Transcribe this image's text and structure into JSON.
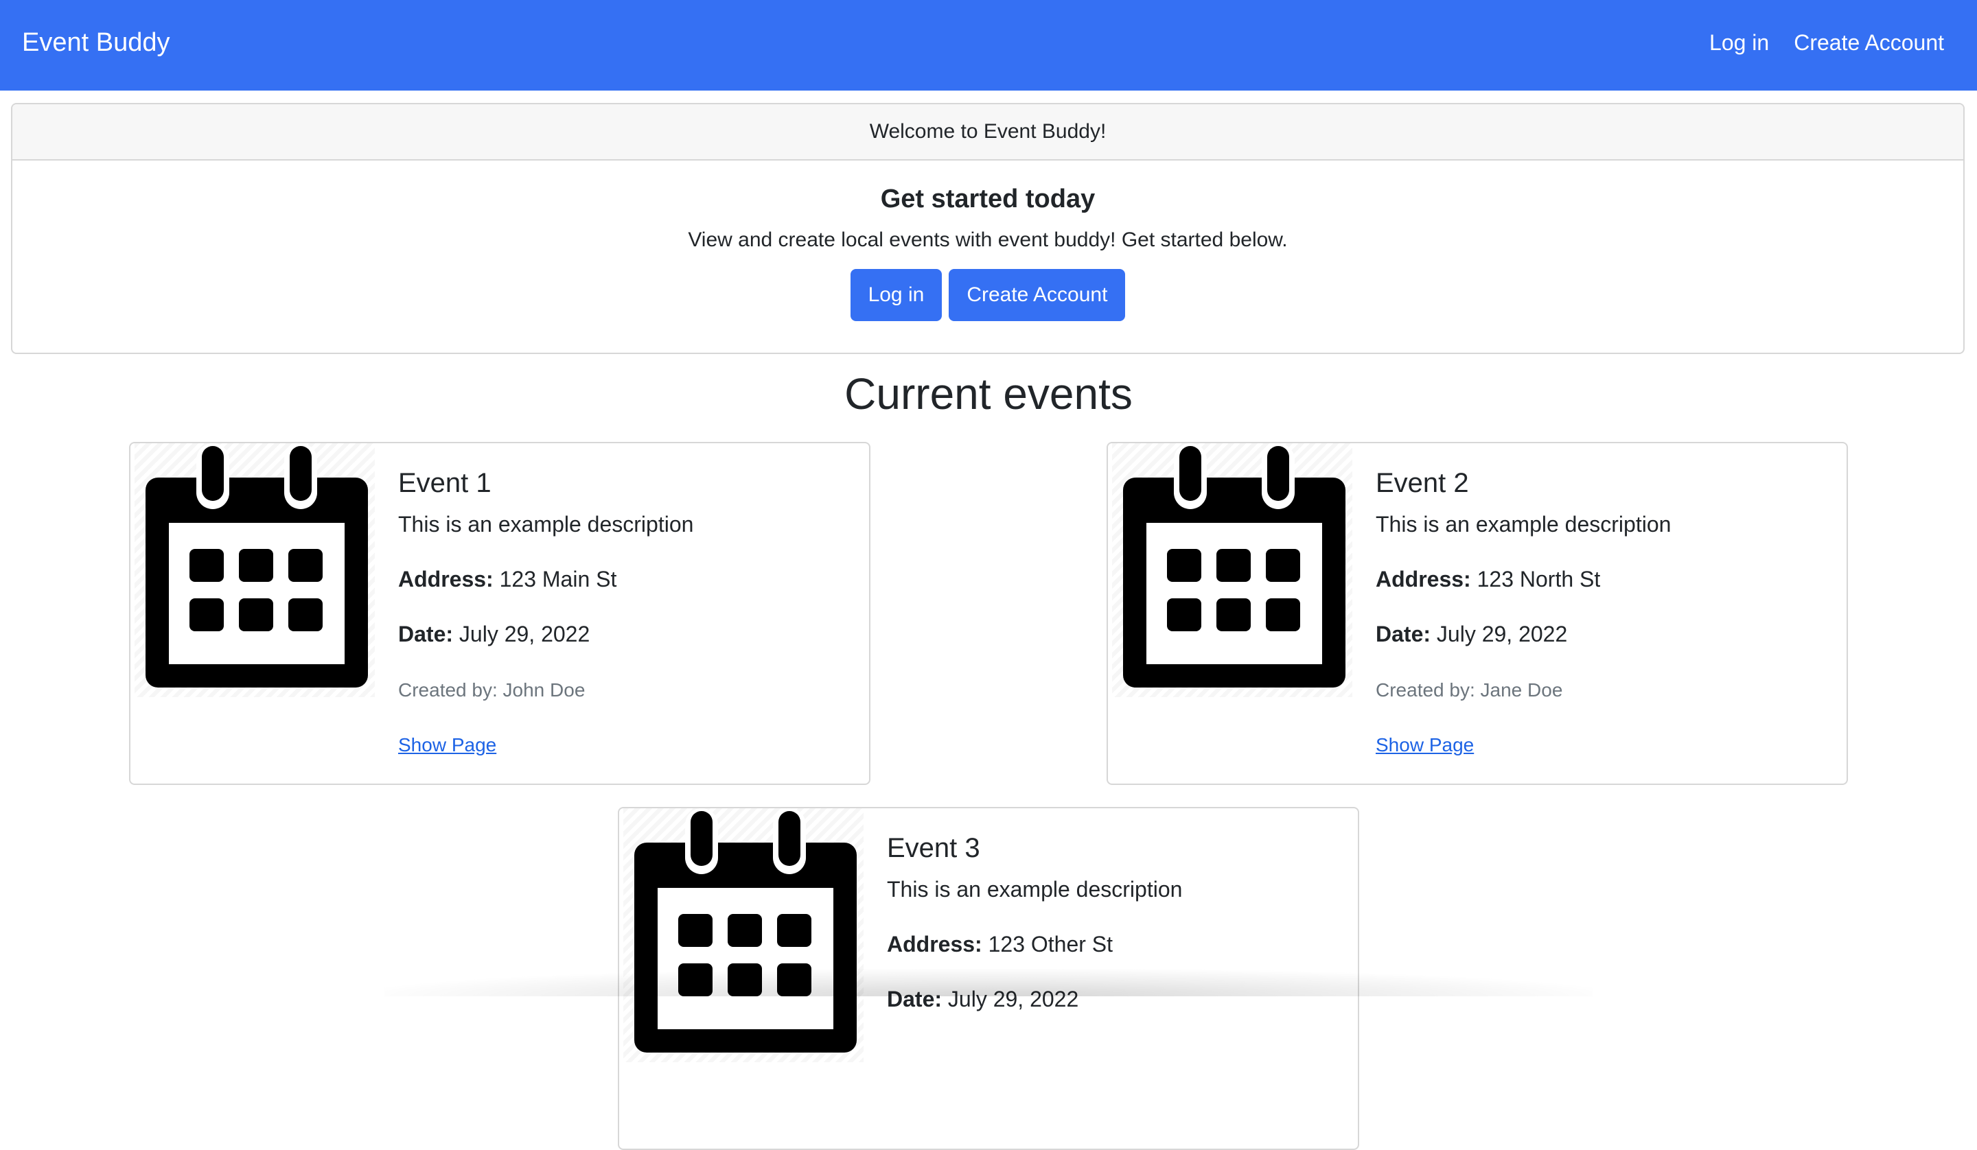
{
  "navbar": {
    "brand": "Event Buddy",
    "links": [
      {
        "label": "Log in"
      },
      {
        "label": "Create Account"
      }
    ],
    "background_color": "#3570f3"
  },
  "welcome": {
    "header": "Welcome to Event Buddy!",
    "title": "Get started today",
    "text": "View and create local events with event buddy! Get started below.",
    "login_button": "Log in",
    "create_account_button": "Create Account"
  },
  "events_section": {
    "title": "Current events",
    "address_label": "Address:",
    "date_label": "Date:",
    "events": [
      {
        "title": "Event 1",
        "description": "This is an example description",
        "address": "123 Main St",
        "date": "July 29, 2022",
        "created_by": "Created by: John Doe",
        "link_label": "Show Page",
        "icon": "calendar-icon"
      },
      {
        "title": "Event 2",
        "description": "This is an example description",
        "address": "123 North St",
        "date": "July 29, 2022",
        "created_by": "Created by: Jane Doe",
        "link_label": "Show Page",
        "icon": "calendar-icon"
      },
      {
        "title": "Event 3",
        "description": "This is an example description",
        "address": "123 Other St",
        "date": "July 29, 2022",
        "created_by": "",
        "link_label": "",
        "icon": "calendar-icon"
      }
    ]
  },
  "colors": {
    "primary": "#3570f3",
    "link": "#1d63e5",
    "muted_text": "#6c757d",
    "border": "#d7d7d7"
  }
}
